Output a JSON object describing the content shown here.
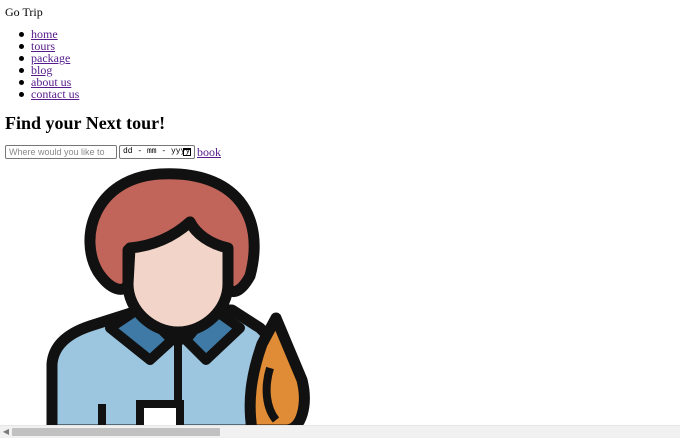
{
  "header": {
    "brand": "Go Trip"
  },
  "nav": {
    "items": [
      {
        "label": "home"
      },
      {
        "label": "tours"
      },
      {
        "label": "package"
      },
      {
        "label": "blog"
      },
      {
        "label": "about us"
      },
      {
        "label": "contact us"
      }
    ]
  },
  "hero": {
    "heading": "Find your Next tour!",
    "search": {
      "where_placeholder": "Where would you like to",
      "where_value": "",
      "date_placeholder": "dd - mm - yyyy",
      "book_label": "book"
    }
  },
  "illustration": {
    "icon": "traveler-person-icon"
  },
  "colors": {
    "hair": "#c1655a",
    "skin": "#f2d4c8",
    "collar": "#3e7aa5",
    "shirt": "#9cc5e0",
    "orange": "#e08b35",
    "outline": "#111111",
    "link_visited": "#551a8b"
  },
  "scrollbar": {
    "horizontal_position": 0.0
  }
}
